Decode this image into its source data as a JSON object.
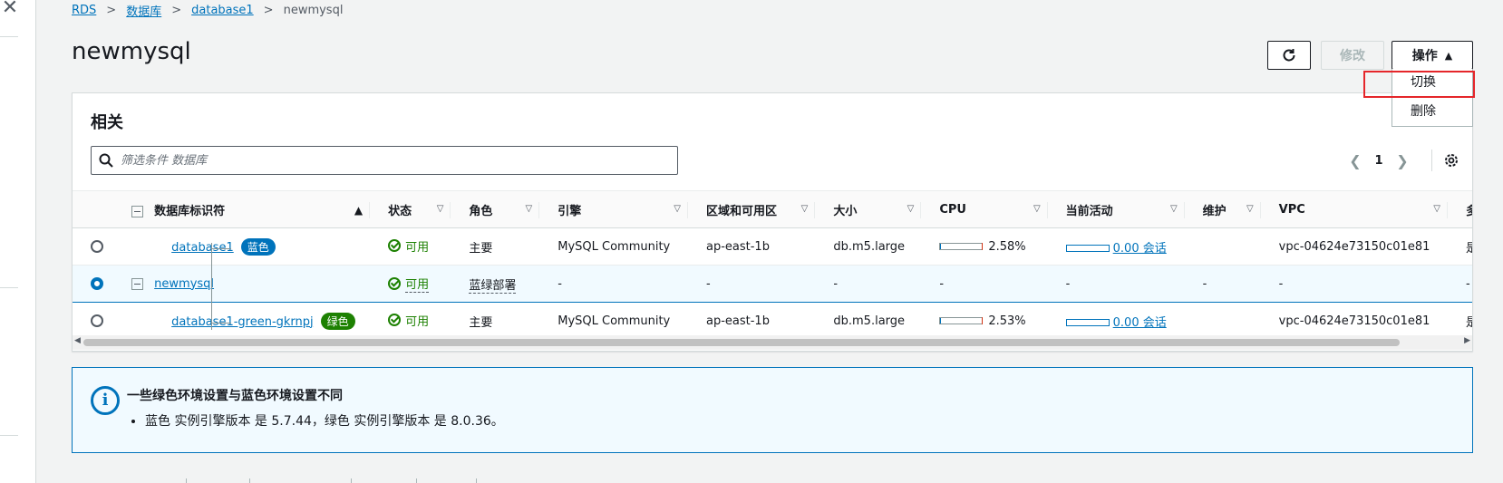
{
  "breadcrumb": {
    "items": [
      "RDS",
      "数据库",
      "database1"
    ],
    "current": "newmysql"
  },
  "page": {
    "title": "newmysql"
  },
  "header_buttons": {
    "refresh_icon": "refresh-icon",
    "modify_label": "修改",
    "actions_label": "操作"
  },
  "actions_menu": {
    "items": [
      "切换",
      "删除"
    ]
  },
  "related": {
    "title": "相关",
    "search_placeholder": "筛选条件 数据库",
    "pager": {
      "current_page": "1"
    },
    "columns": [
      "数据库标识符",
      "状态",
      "角色",
      "引擎",
      "区域和可用区",
      "大小",
      "CPU",
      "当前活动",
      "维护",
      "VPC",
      "多可"
    ],
    "rows": [
      {
        "id": "database1",
        "badge": "蓝色",
        "status": "可用",
        "role": "主要",
        "engine": "MySQL Community",
        "zone": "ap-east-1b",
        "size": "db.m5.large",
        "cpu": "2.58%",
        "activity": "0.00 会话",
        "maintenance": "",
        "vpc": "vpc-04624e73150c01e81",
        "multi_az": "是"
      },
      {
        "id": "newmysql",
        "badge": "",
        "status": "可用",
        "role": "蓝绿部署",
        "engine": "-",
        "zone": "-",
        "size": "-",
        "cpu": "-",
        "activity": "-",
        "maintenance": "-",
        "vpc": "-",
        "multi_az": "-"
      },
      {
        "id": "database1-green-gkrnpj",
        "badge": "绿色",
        "status": "可用",
        "role": "主要",
        "engine": "MySQL Community",
        "zone": "ap-east-1b",
        "size": "db.m5.large",
        "cpu": "2.53%",
        "activity": "0.00 会话",
        "maintenance": "",
        "vpc": "vpc-04624e73150c01e81",
        "multi_az": "是"
      }
    ]
  },
  "alert": {
    "title": "一些绿色环境设置与蓝色环境设置不同",
    "items": [
      "蓝色 实例引擎版本 是 5.7.44，绿色 实例引擎版本 是 8.0.36。"
    ]
  },
  "colors": {
    "link": "#0073bb",
    "success": "#1d8102",
    "highlight": "#e5262a",
    "badge_blue": "#0073bb",
    "badge_green": "#1d8102"
  }
}
